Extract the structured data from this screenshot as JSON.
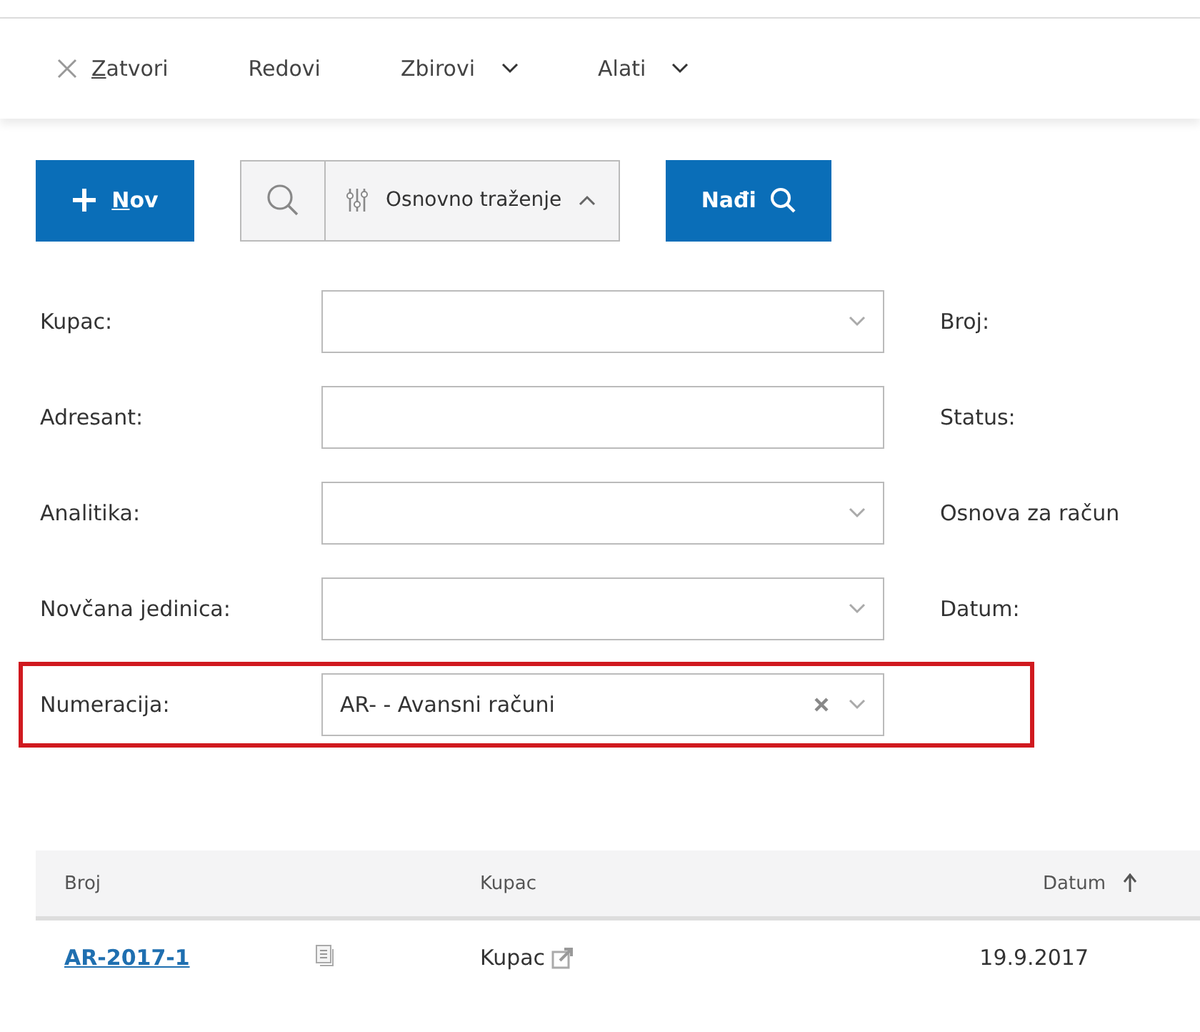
{
  "toolbar": [
    {
      "label": "Zatvori",
      "kind": "close",
      "underline_first": true,
      "dropdown": false
    },
    {
      "label": "Redovi",
      "kind": "plain",
      "underline_first": false,
      "dropdown": false
    },
    {
      "label": "Zbirovi",
      "kind": "plain",
      "underline_first": false,
      "dropdown": true
    },
    {
      "label": "Alati",
      "kind": "plain",
      "underline_first": false,
      "dropdown": true
    }
  ],
  "new_button": {
    "label": "Nov",
    "underline_first": true
  },
  "search_mode": {
    "label": "Osnovno traženje",
    "expanded": true
  },
  "find_button": {
    "label": "Nađi"
  },
  "filters": [
    {
      "label": "Kupac:",
      "kind": "select",
      "clearable": false,
      "highlighted": false,
      "right_label": "Broj:"
    },
    {
      "label": "Adresant:",
      "kind": "text",
      "clearable": false,
      "highlighted": false,
      "right_label": "Status:"
    },
    {
      "label": "Analitika:",
      "kind": "select",
      "clearable": false,
      "highlighted": false,
      "right_label": "Osnova za račun"
    },
    {
      "label": "Novčana jedinica:",
      "kind": "select",
      "clearable": false,
      "highlighted": false,
      "right_label": "Datum:"
    },
    {
      "label": "Numeracija:",
      "kind": "select",
      "value": "AR- - Avansni računi",
      "clearable": true,
      "highlighted": true
    }
  ],
  "table": {
    "columns": [
      {
        "label": "Broj",
        "sorted": false
      },
      {
        "label": "Kupac",
        "sorted": false
      },
      {
        "label": "Datum",
        "sorted": true
      }
    ],
    "rows": [
      {
        "number": "AR-2017-1",
        "customer": "Kupac",
        "date": "19.9.2017"
      }
    ]
  }
}
